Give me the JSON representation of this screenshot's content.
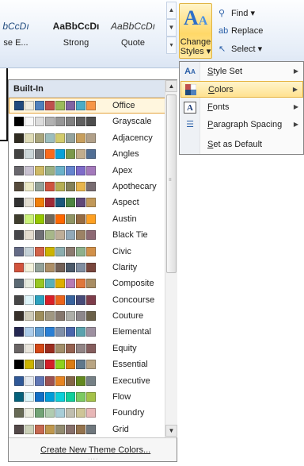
{
  "ribbon": {
    "styles": [
      {
        "sample": "bCcDı",
        "name": "se E..."
      },
      {
        "sample": "AaBbCcDı",
        "name": "Strong"
      },
      {
        "sample": "AaBbCcDı",
        "name": "Quote"
      }
    ],
    "change_styles": {
      "line1": "Change",
      "line2": "Styles ▾"
    },
    "editing": {
      "find": "Find ▾",
      "replace": "Replace",
      "select": "Select ▾"
    }
  },
  "gallery": {
    "header": "Built-In",
    "themes": [
      {
        "name": "Office",
        "colors": [
          "#1f497d",
          "#eeece1",
          "#4f81bd",
          "#c0504d",
          "#9bbb59",
          "#8064a2",
          "#4bacc6",
          "#f79646"
        ]
      },
      {
        "name": "Grayscale",
        "colors": [
          "#000000",
          "#f8f8f8",
          "#dddddd",
          "#b2b2b2",
          "#969696",
          "#808080",
          "#5f5f5f",
          "#4d4d4d"
        ]
      },
      {
        "name": "Adjacency",
        "colors": [
          "#2f2b20",
          "#dfdcb7",
          "#a9a57c",
          "#9cbebd",
          "#d2cb6c",
          "#95a39d",
          "#c89f5d",
          "#b1a089"
        ]
      },
      {
        "name": "Angles",
        "colors": [
          "#434342",
          "#cdd7d9",
          "#797b7e",
          "#f96a1b",
          "#08a1d9",
          "#7c984a",
          "#c2ad8d",
          "#506e94"
        ]
      },
      {
        "name": "Apex",
        "colors": [
          "#69676d",
          "#c9c2d1",
          "#ceb966",
          "#9cb084",
          "#6bb1c9",
          "#6585cf",
          "#7e6bc9",
          "#a379bb"
        ]
      },
      {
        "name": "Apothecary",
        "colors": [
          "#564b3c",
          "#ece9c6",
          "#93a299",
          "#cf543f",
          "#b5ae53",
          "#848058",
          "#e8b54d",
          "#786c71"
        ]
      },
      {
        "name": "Aspect",
        "colors": [
          "#323232",
          "#e3ded1",
          "#f07f09",
          "#9f2936",
          "#1b587c",
          "#4e8542",
          "#604878",
          "#c19859"
        ]
      },
      {
        "name": "Austin",
        "colors": [
          "#3e3d2d",
          "#caf278",
          "#94c600",
          "#71685a",
          "#ff6700",
          "#909465",
          "#956b43",
          "#fea022"
        ]
      },
      {
        "name": "Black Tie",
        "colors": [
          "#46464a",
          "#e3dcCF",
          "#6f6f74",
          "#a7b789",
          "#beae98",
          "#92a9b9",
          "#9c8265",
          "#8d6974"
        ]
      },
      {
        "name": "Civic",
        "colors": [
          "#646b86",
          "#c5d1d7",
          "#d16349",
          "#ccb400",
          "#8cadae",
          "#8c7b70",
          "#8fb08c",
          "#d19049"
        ]
      },
      {
        "name": "Clarity",
        "colors": [
          "#d2533c",
          "#f3f2dc",
          "#93a299",
          "#ad8f67",
          "#726056",
          "#4c5a6a",
          "#808da0",
          "#79463d"
        ]
      },
      {
        "name": "Composite",
        "colors": [
          "#5b6973",
          "#e7ecdf",
          "#98c723",
          "#59b0b9",
          "#deae00",
          "#b77bb4",
          "#e0773c",
          "#a98d63"
        ]
      },
      {
        "name": "Concourse",
        "colors": [
          "#464646",
          "#def5fa",
          "#2da2bf",
          "#da1f28",
          "#eb641b",
          "#39639d",
          "#474b78",
          "#7d3c4a"
        ]
      },
      {
        "name": "Couture",
        "colors": [
          "#37302a",
          "#d0ccb9",
          "#9e8e5c",
          "#a09781",
          "#85776d",
          "#aeafa9",
          "#8d878b",
          "#6b6149"
        ]
      },
      {
        "name": "Elemental",
        "colors": [
          "#242852",
          "#acccea",
          "#629dd1",
          "#297fd5",
          "#7f8fa9",
          "#4a66ac",
          "#5aa2ae",
          "#9d90a0"
        ]
      },
      {
        "name": "Equity",
        "colors": [
          "#696464",
          "#e9e5dc",
          "#d34817",
          "#9b2d1f",
          "#a28e6a",
          "#956251",
          "#918485",
          "#855d5d"
        ]
      },
      {
        "name": "Essential",
        "colors": [
          "#000000",
          "#ccb400",
          "#7a7a7a",
          "#d31f28",
          "#8fd11e",
          "#da7c14",
          "#60788c",
          "#b9a583"
        ]
      },
      {
        "name": "Executive",
        "colors": [
          "#2f5897",
          "#e4e9ef",
          "#6076b4",
          "#9c5252",
          "#e68422",
          "#846648",
          "#63891f",
          "#758085"
        ]
      },
      {
        "name": "Flow",
        "colors": [
          "#04617b",
          "#dbf5f9",
          "#0f6fc6",
          "#009dd9",
          "#0bd0d9",
          "#10cf9b",
          "#7cca62",
          "#a5c249"
        ]
      },
      {
        "name": "Foundry",
        "colors": [
          "#676a55",
          "#eaebde",
          "#72a376",
          "#b0ccb0",
          "#a8cdd7",
          "#c0beaf",
          "#cec597",
          "#e8b7b7"
        ]
      },
      {
        "name": "Grid",
        "colors": [
          "#534949",
          "#ccd1b9",
          "#c66951",
          "#bf974d",
          "#928b70",
          "#87706b",
          "#94734e",
          "#6f777d"
        ]
      }
    ],
    "footer": {
      "create": "Create New Theme Colors..."
    }
  },
  "menu": {
    "items": [
      {
        "label": "Style Set",
        "icon": "style-set-icon"
      },
      {
        "label": "Colors",
        "icon": "colors-icon"
      },
      {
        "label": "Fonts",
        "icon": "fonts-icon"
      },
      {
        "label": "Paragraph Spacing",
        "icon": "paragraph-spacing-icon"
      },
      {
        "label": "Set as Default",
        "icon": ""
      }
    ]
  },
  "colors": {
    "accent_highlight": "#ffe28f",
    "border": "#868686"
  }
}
